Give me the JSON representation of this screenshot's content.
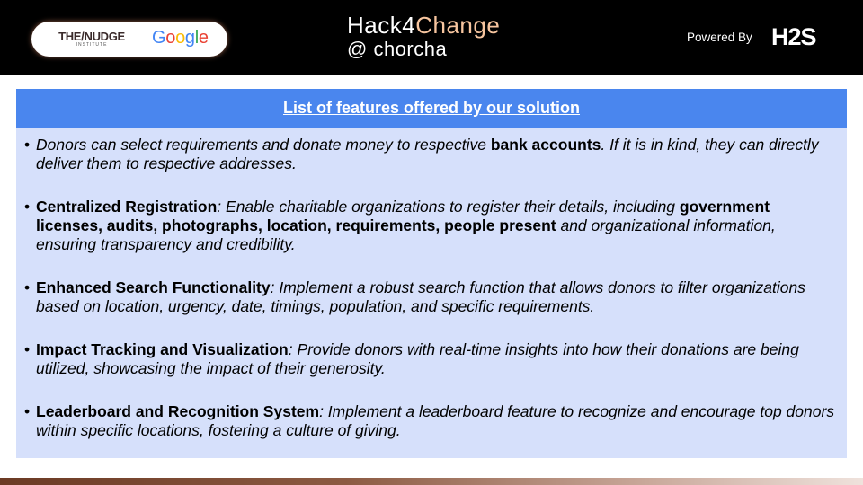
{
  "header": {
    "partner_left": "THE/NUDGE",
    "partner_left_sub": "INSTITUTE",
    "partner_right": [
      "G",
      "o",
      "o",
      "g",
      "l",
      "e"
    ],
    "event_title_1": "Hack4",
    "event_title_2": "Change",
    "event_sub": "@ chorcha",
    "powered_by": "Powered By",
    "sponsor_logo": "H2S"
  },
  "panel": {
    "title": "List of features offered by our solution",
    "features": [
      {
        "pre": "Donors can select requirements and donate money to respective ",
        "bold": "bank accounts",
        "post": ". If it is in kind, they can directly deliver them to respective addresses."
      },
      {
        "bold": "Centralized Registration",
        "mid": ": Enable charitable organizations to register their details, including ",
        "bold2": "government licenses, audits, photographs, location, requirements, people present",
        "post": " and organizational information, ensuring transparency and credibility."
      },
      {
        "bold": "Enhanced Search Functionality",
        "post": ": Implement a robust search function that allows donors to filter organizations based on location, urgency, date, timings, population, and specific requirements."
      },
      {
        "bold": "Impact Tracking and Visualization",
        "post": ": Provide donors with real-time insights into how their donations are being utilized, showcasing the impact of their generosity."
      },
      {
        "bold": "Leaderboard and Recognition System",
        "post": ": Implement a leaderboard feature to recognize and encourage top donors within specific locations, fostering a culture of giving."
      }
    ]
  },
  "colors": {
    "header_bg": "#000000",
    "panel_header_bg": "#4a86ee",
    "panel_body_bg": "#d6e0fb",
    "accent": "#f7c59f"
  }
}
